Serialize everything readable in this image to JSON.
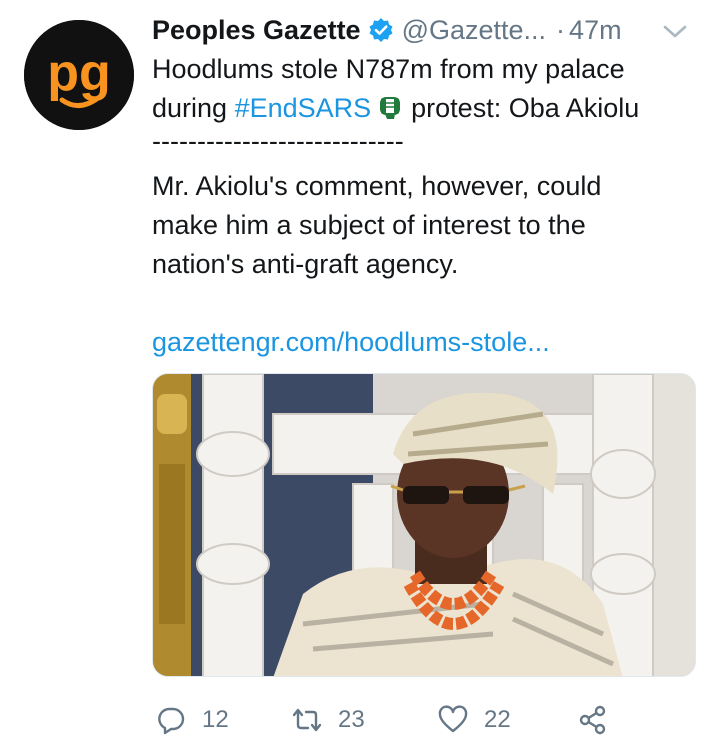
{
  "account": {
    "name": "Peoples Gazette",
    "handle": "@Gazette...",
    "separator": "·",
    "time": "47m",
    "avatar_text": "pg"
  },
  "tweet": {
    "line1": "Hoodlums stole N787m from my palace",
    "line2_prefix": "during ",
    "hashtag": "#EndSARS",
    "line2_suffix": "protest: Oba Akiolu",
    "divider": "----------------------------",
    "body_line1": "Mr. Akiolu's comment, however, could",
    "body_line2": "make him a subject of interest to the",
    "body_line3": "nation's anti-graft agency.",
    "link": "gazettengr.com/hoodlums-stole..."
  },
  "actions": {
    "reply_count": "12",
    "retweet_count": "23",
    "like_count": "22"
  },
  "colors": {
    "link": "#1b95e0",
    "muted": "#657786",
    "verified": "#1da1f2",
    "avatar_bg": "#111111",
    "brand_orange": "#f7931e"
  }
}
